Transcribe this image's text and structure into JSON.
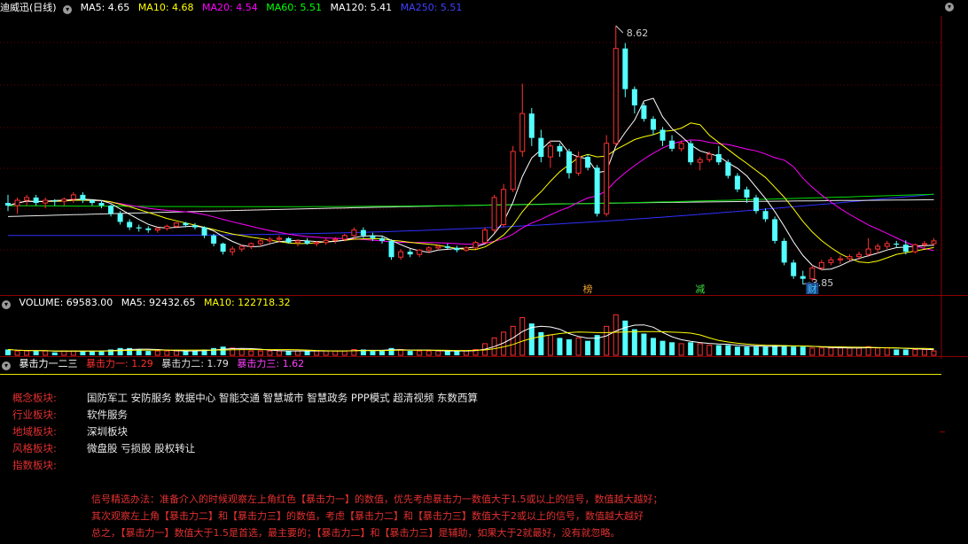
{
  "header": {
    "stock_name": "迪威迅(日线)",
    "ma": [
      {
        "label": "MA5: 4.65",
        "color": "#ffffff"
      },
      {
        "label": "MA10: 4.68",
        "color": "#ffff00"
      },
      {
        "label": "MA20: 4.54",
        "color": "#ff00ff"
      },
      {
        "label": "MA60: 5.51",
        "color": "#00ff00"
      },
      {
        "label": "MA120: 5.41",
        "color": "#ffffff"
      },
      {
        "label": "MA250: 5.51",
        "color": "#4040ff"
      }
    ]
  },
  "volume_header": {
    "title": "VOLUME: 69583.00",
    "ma5": "MA5: 92432.65",
    "ma10": "MA10: 122718.32"
  },
  "indicator_header": {
    "name": "暴击力一二三",
    "i1": "暴击力一: 1.29",
    "i2": "暴击力二: 1.79",
    "i3": "暴击力三: 1.62",
    "c1": "#ff3030",
    "c2": "#e0e0e0",
    "c3": "#ff40ff"
  },
  "price_annotations": {
    "high": "8.62",
    "low": "3.85",
    "markers": [
      "榜",
      "减",
      "财"
    ]
  },
  "info": {
    "concept_label": "概念板块:",
    "concept_value": "国防军工 安防服务 数据中心 智能交通 智慧城市 智慧政务 PPP模式 超清视频 东数西算",
    "industry_label": "行业板块:",
    "industry_value": "软件服务",
    "region_label": "地域板块:",
    "region_value": "深圳板块",
    "style_label": "风格板块:",
    "style_value": "微盘股 亏损股 股权转让",
    "index_label": "指数板块:",
    "index_value": ""
  },
  "signal": {
    "line1": "信号精选办法：准备介入的时候观察左上角红色【暴击力一】的数值，优先考虑暴击力一数值大于1.5或以上的信号，数值越大越好；",
    "line2": "其次观察左上角【暴击力二】和【暴击力三】的数值，考虑【暴击力二】和【暴击力三】数值大于2或以上的信号，数值越大越好",
    "line3": "总之，【暴击力一】数值大于1.5是首选，最主要的；【暴击力二】和【暴击力三】是辅助，如果大于2就最好，没有就忽略。"
  },
  "chart_data": {
    "type": "candlestick",
    "ohlc": [
      [
        5.35,
        5.5,
        5.2,
        5.3
      ],
      [
        5.3,
        5.45,
        5.15,
        5.4
      ],
      [
        5.4,
        5.5,
        5.3,
        5.45
      ],
      [
        5.45,
        5.5,
        5.3,
        5.35
      ],
      [
        5.35,
        5.45,
        5.25,
        5.4
      ],
      [
        5.4,
        5.42,
        5.3,
        5.38
      ],
      [
        5.38,
        5.45,
        5.3,
        5.42
      ],
      [
        5.42,
        5.55,
        5.35,
        5.5
      ],
      [
        5.5,
        5.55,
        5.35,
        5.4
      ],
      [
        5.4,
        5.42,
        5.3,
        5.35
      ],
      [
        5.35,
        5.4,
        5.25,
        5.3
      ],
      [
        5.3,
        5.32,
        5.1,
        5.15
      ],
      [
        5.15,
        5.2,
        4.95,
        5.0
      ],
      [
        5.0,
        5.05,
        4.85,
        4.9
      ],
      [
        4.9,
        4.95,
        4.82,
        4.88
      ],
      [
        4.88,
        4.92,
        4.8,
        4.85
      ],
      [
        4.85,
        4.9,
        4.8,
        4.88
      ],
      [
        4.88,
        4.95,
        4.84,
        4.92
      ],
      [
        4.92,
        5.0,
        4.88,
        4.98
      ],
      [
        4.98,
        5.0,
        4.9,
        4.94
      ],
      [
        4.94,
        4.98,
        4.86,
        4.9
      ],
      [
        4.9,
        4.92,
        4.7,
        4.75
      ],
      [
        4.75,
        4.78,
        4.55,
        4.6
      ],
      [
        4.6,
        4.62,
        4.4,
        4.45
      ],
      [
        4.45,
        4.55,
        4.38,
        4.5
      ],
      [
        4.5,
        4.58,
        4.45,
        4.55
      ],
      [
        4.55,
        4.62,
        4.5,
        4.6
      ],
      [
        4.6,
        4.7,
        4.55,
        4.65
      ],
      [
        4.65,
        4.72,
        4.6,
        4.68
      ],
      [
        4.68,
        4.75,
        4.62,
        4.7
      ],
      [
        4.7,
        4.72,
        4.6,
        4.62
      ],
      [
        4.62,
        4.68,
        4.55,
        4.65
      ],
      [
        4.65,
        4.7,
        4.58,
        4.6
      ],
      [
        4.6,
        4.65,
        4.55,
        4.62
      ],
      [
        4.62,
        4.7,
        4.58,
        4.66
      ],
      [
        4.66,
        4.72,
        4.6,
        4.68
      ],
      [
        4.68,
        4.78,
        4.64,
        4.75
      ],
      [
        4.75,
        4.9,
        4.7,
        4.85
      ],
      [
        4.85,
        4.9,
        4.7,
        4.75
      ],
      [
        4.75,
        4.8,
        4.65,
        4.7
      ],
      [
        4.7,
        4.75,
        4.6,
        4.65
      ],
      [
        4.65,
        4.68,
        4.3,
        4.35
      ],
      [
        4.35,
        4.5,
        4.3,
        4.45
      ],
      [
        4.45,
        4.5,
        4.35,
        4.4
      ],
      [
        4.4,
        4.5,
        4.35,
        4.48
      ],
      [
        4.48,
        4.55,
        4.42,
        4.52
      ],
      [
        4.52,
        4.58,
        4.48,
        4.55
      ],
      [
        4.55,
        4.6,
        4.5,
        4.52
      ],
      [
        4.52,
        4.56,
        4.44,
        4.48
      ],
      [
        4.48,
        4.55,
        4.45,
        4.52
      ],
      [
        4.52,
        4.65,
        4.5,
        4.62
      ],
      [
        4.62,
        4.9,
        4.6,
        4.85
      ],
      [
        4.85,
        5.5,
        4.8,
        5.45
      ],
      [
        4.95,
        5.7,
        4.9,
        5.6
      ],
      [
        5.6,
        6.4,
        5.55,
        6.3
      ],
      [
        6.3,
        7.55,
        6.2,
        7.0
      ],
      [
        7.0,
        7.1,
        6.4,
        6.55
      ],
      [
        6.55,
        6.7,
        6.1,
        6.2
      ],
      [
        6.2,
        6.5,
        6.0,
        6.4
      ],
      [
        6.4,
        6.45,
        6.2,
        6.3
      ],
      [
        6.3,
        6.35,
        5.8,
        5.9
      ],
      [
        5.9,
        6.3,
        5.85,
        6.2
      ],
      [
        6.2,
        6.25,
        5.95,
        6.0
      ],
      [
        6.0,
        6.05,
        5.1,
        5.15
      ],
      [
        5.15,
        6.6,
        5.1,
        6.45
      ],
      [
        6.45,
        8.62,
        6.4,
        8.2
      ],
      [
        8.2,
        8.3,
        7.3,
        7.45
      ],
      [
        7.45,
        7.5,
        7.0,
        7.15
      ],
      [
        7.15,
        7.2,
        6.85,
        6.9
      ],
      [
        6.9,
        6.95,
        6.6,
        6.7
      ],
      [
        6.7,
        6.75,
        6.4,
        6.5
      ],
      [
        6.5,
        6.6,
        6.3,
        6.35
      ],
      [
        6.35,
        6.5,
        6.3,
        6.45
      ],
      [
        6.45,
        6.5,
        6.05,
        6.1
      ],
      [
        6.1,
        6.2,
        5.95,
        6.15
      ],
      [
        6.15,
        6.3,
        6.1,
        6.25
      ],
      [
        6.25,
        6.4,
        6.05,
        6.1
      ],
      [
        6.1,
        6.15,
        5.8,
        5.85
      ],
      [
        5.85,
        5.9,
        5.55,
        5.6
      ],
      [
        5.6,
        5.65,
        5.35,
        5.45
      ],
      [
        5.45,
        5.5,
        5.15,
        5.2
      ],
      [
        5.2,
        5.25,
        5.0,
        5.05
      ],
      [
        5.05,
        5.1,
        4.6,
        4.65
      ],
      [
        4.65,
        4.7,
        4.2,
        4.25
      ],
      [
        4.25,
        4.3,
        3.95,
        4.0
      ],
      [
        4.0,
        4.1,
        3.85,
        3.95
      ],
      [
        3.95,
        4.2,
        3.9,
        4.15
      ],
      [
        4.15,
        4.3,
        4.1,
        4.25
      ],
      [
        4.25,
        4.35,
        4.2,
        4.3
      ],
      [
        4.3,
        4.38,
        4.22,
        4.32
      ],
      [
        4.32,
        4.4,
        4.28,
        4.36
      ],
      [
        4.36,
        4.45,
        4.3,
        4.4
      ],
      [
        4.4,
        4.7,
        4.35,
        4.5
      ],
      [
        4.5,
        4.6,
        4.42,
        4.55
      ],
      [
        4.55,
        4.65,
        4.5,
        4.6
      ],
      [
        4.6,
        4.65,
        4.52,
        4.58
      ],
      [
        4.58,
        4.66,
        4.4,
        4.45
      ],
      [
        4.45,
        4.6,
        4.42,
        4.58
      ],
      [
        4.58,
        4.65,
        4.52,
        4.6
      ],
      [
        4.6,
        4.7,
        4.55,
        4.65
      ]
    ],
    "ma5_final": 4.65,
    "ma10_final": 4.68,
    "ma20_final": 4.54,
    "ma60_final": 5.51,
    "ma120_final": 5.41,
    "ma250_final": 5.51,
    "ma60": {
      "start": 5.3,
      "end": 5.51
    },
    "ma120": {
      "start": 5.1,
      "end": 5.41
    },
    "ma250": {
      "start": 4.75,
      "end": 5.51
    },
    "volume": [
      4,
      3,
      3,
      3,
      3,
      2,
      3,
      3,
      3,
      3,
      3,
      4,
      5,
      5,
      4,
      3,
      3,
      3,
      3,
      3,
      3,
      4,
      5,
      6,
      5,
      4,
      3,
      3,
      3,
      3,
      3,
      3,
      3,
      3,
      3,
      3,
      3,
      4,
      4,
      3,
      3,
      5,
      4,
      3,
      3,
      3,
      3,
      3,
      3,
      3,
      4,
      8,
      12,
      16,
      20,
      26,
      22,
      16,
      14,
      12,
      11,
      12,
      10,
      14,
      20,
      28,
      24,
      18,
      15,
      12,
      10,
      9,
      8,
      9,
      8,
      7,
      7,
      7,
      6,
      6,
      6,
      6,
      7,
      7,
      6,
      6,
      5,
      5,
      5,
      5,
      5,
      5,
      6,
      5,
      5,
      4,
      4,
      4,
      4,
      3
    ],
    "volume_max": 30,
    "ylim": [
      3.7,
      8.8
    ]
  }
}
